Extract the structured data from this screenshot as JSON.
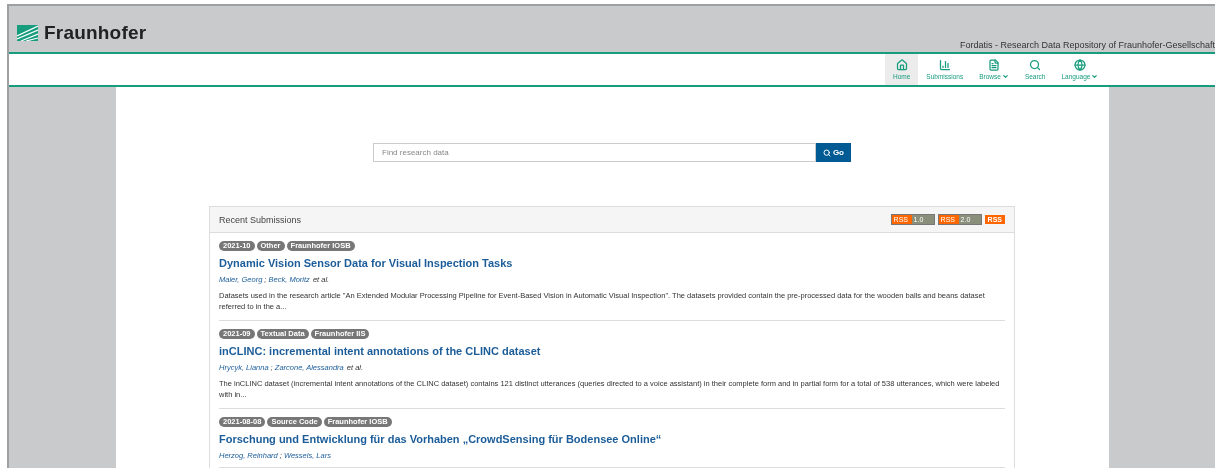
{
  "header": {
    "brand": "Fraunhofer",
    "site_title": "Fordatis - Research Data Repository of Fraunhofer-Gesellschaft"
  },
  "nav": [
    {
      "label": "Home",
      "selected": true,
      "dropdown": false
    },
    {
      "label": "Submissions",
      "selected": false,
      "dropdown": false
    },
    {
      "label": "Browse",
      "selected": false,
      "dropdown": true
    },
    {
      "label": "Search",
      "selected": false,
      "dropdown": false
    },
    {
      "label": "Language",
      "selected": false,
      "dropdown": true
    }
  ],
  "search": {
    "placeholder": "Find research data",
    "button": "Go"
  },
  "recent": {
    "title": "Recent Submissions",
    "feeds": [
      {
        "label": "RSS",
        "version": "1.0"
      },
      {
        "label": "RSS",
        "version": "2.0"
      }
    ],
    "rss_label": "RSS",
    "author_separator": ";",
    "items": [
      {
        "tags": [
          "2021-10",
          "Other",
          "Fraunhofer IOSB"
        ],
        "title": "Dynamic Vision Sensor Data for Visual Inspection Tasks",
        "authors": [
          "Maier, Georg",
          "Beck, Moritz"
        ],
        "authors_suffix": "et al.",
        "abstract": "Datasets used in the research article \"An Extended Modular Processing Pipeline for Event-Based Vision in Automatic Visual Inspection\". The datasets provided contain the pre-processed data for the wooden balls and beans dataset referred to in the a..."
      },
      {
        "tags": [
          "2021-09",
          "Textual Data",
          "Fraunhofer IIS"
        ],
        "title": "inCLINC: incremental intent annotations of the CLINC dataset",
        "authors": [
          "Hrycyk, Lianna",
          "Zarcone, Alessandra"
        ],
        "authors_suffix": "et al.",
        "abstract": "The inCLINC dataset (incremental intent annotations of the CLINC dataset) contains 121 distinct utterances (queries directed to a voice assistant) in their complete form and in partial form for a total of 538 utterances, which were labeled with in..."
      },
      {
        "tags": [
          "2021-08-08",
          "Source Code",
          "Fraunhofer IOSB"
        ],
        "title": "Forschung und Entwicklung für das Vorhaben „CrowdSensing für Bodensee Online“",
        "authors": [
          "Herzog, Reinhard",
          "Wessels, Lars"
        ]
      }
    ]
  }
}
